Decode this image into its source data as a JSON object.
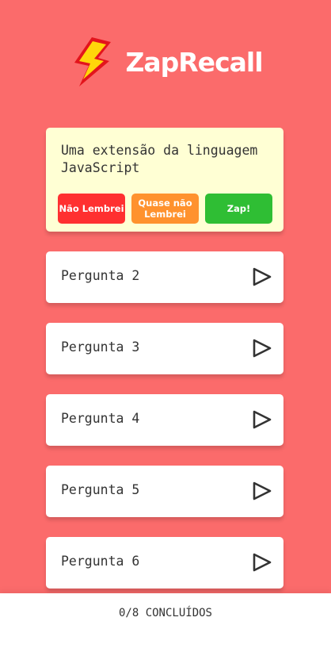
{
  "header": {
    "title": "ZapRecall",
    "logo_icon": "lightning-bolt-icon",
    "logo_colors": {
      "fill": "#ffd60a",
      "outline": "#e3141c"
    }
  },
  "open_card": {
    "question": "Uma extensão da linguagem JavaScript",
    "buttons": {
      "not_remembered": "Não Lembrei",
      "almost": "Quase não Lembrei",
      "zap": "Zap!"
    },
    "colors": {
      "not_remembered": "#ff3030",
      "almost": "#ff922e",
      "zap": "#2fbe34"
    }
  },
  "cards": [
    {
      "label": "Pergunta 2",
      "icon": "play-icon"
    },
    {
      "label": "Pergunta 3",
      "icon": "play-icon"
    },
    {
      "label": "Pergunta 4",
      "icon": "play-icon"
    },
    {
      "label": "Pergunta 5",
      "icon": "play-icon"
    },
    {
      "label": "Pergunta 6",
      "icon": "play-icon"
    }
  ],
  "footer": {
    "progress": "0/8 CONCLUÍDOS"
  },
  "theme": {
    "background": "#fb6b6b",
    "open_card_bg": "#ffffd4"
  }
}
